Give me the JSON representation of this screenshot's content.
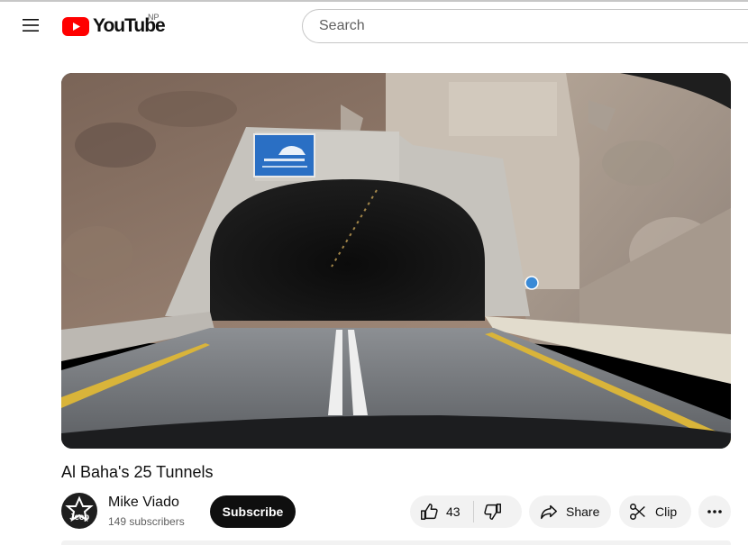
{
  "header": {
    "logo_text": "YouTube",
    "region_code": "NP",
    "search_placeholder": "Search"
  },
  "video": {
    "title": "Al Baha's 25 Tunnels",
    "sign_text_arabic": "اضئ تشغيل الانوار",
    "sign_text_english": "SWITCH ON HEADLIGHTS"
  },
  "channel": {
    "name": "Mike Viado",
    "subscribers": "149 subscribers",
    "avatar_text": "Jeep"
  },
  "actions": {
    "subscribe_label": "Subscribe",
    "like_count": "43",
    "share_label": "Share",
    "clip_label": "Clip"
  },
  "colors": {
    "brand_red": "#ff0000",
    "subscribe_bg": "#0f0f0f",
    "pill_bg": "#f2f2f2"
  },
  "icons": {
    "menu": "hamburger-menu-icon",
    "like": "thumbs-up-icon",
    "dislike": "thumbs-down-icon",
    "share": "share-arrow-icon",
    "clip": "scissors-icon",
    "more": "more-horizontal-icon"
  }
}
